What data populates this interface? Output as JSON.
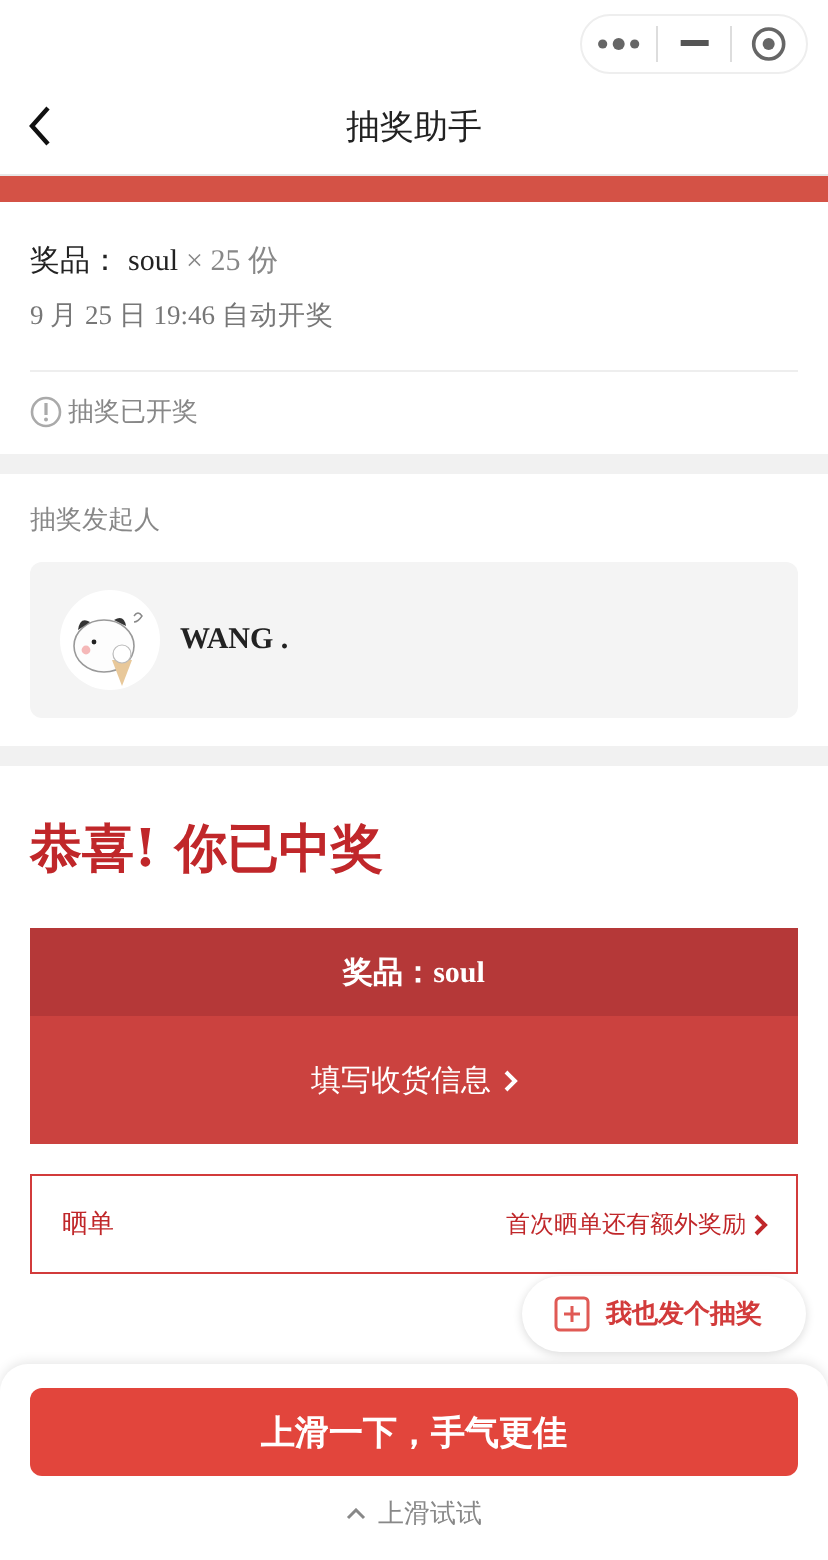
{
  "nav": {
    "title": "抽奖助手"
  },
  "lottery": {
    "prize_label": "奖品：",
    "prize_name": "soul",
    "prize_quantity": "× 25 份",
    "draw_time": "9 月 25 日 19:46 自动开奖",
    "status": "抽奖已开奖"
  },
  "initiator": {
    "heading": "抽奖发起人",
    "name": "WANG ."
  },
  "result": {
    "title": "恭喜! 你已中奖",
    "prize": "奖品：soul",
    "address_button": "填写收货信息"
  },
  "share": {
    "label": "晒单",
    "hint": "首次晒单还有额外奖励"
  },
  "create_button": "我也发个抽奖",
  "bottom": {
    "button": "上滑一下，手气更佳",
    "hint": "上滑试试"
  }
}
